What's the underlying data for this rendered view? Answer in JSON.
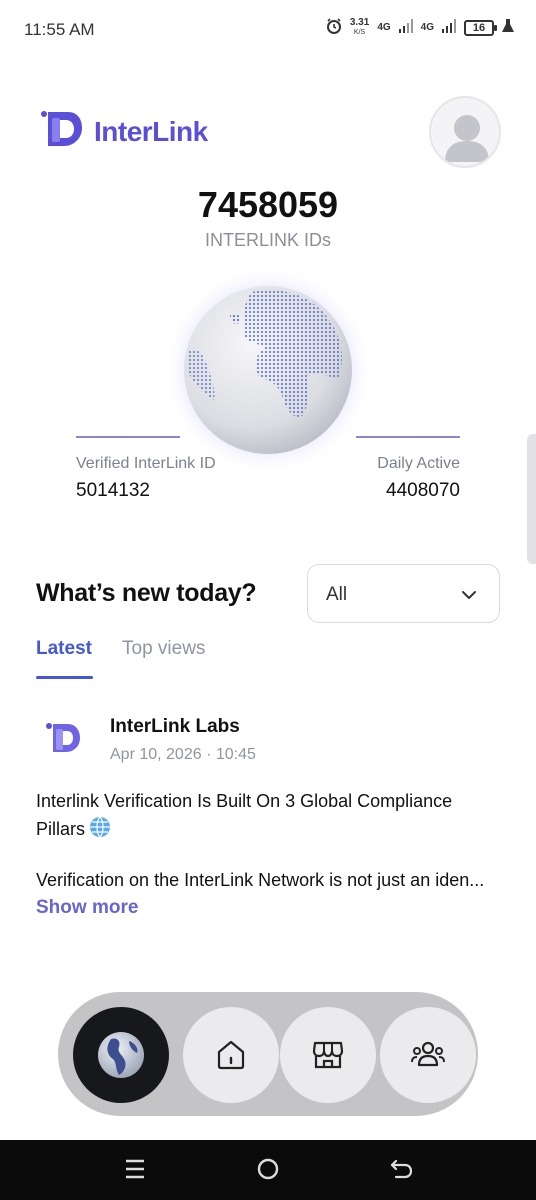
{
  "status_bar": {
    "time": "11:55 AM",
    "speed_value": "3.31",
    "speed_unit": "K/S",
    "network_1": "4G",
    "network_2": "4G",
    "battery": "16"
  },
  "header": {
    "brand": "InterLink"
  },
  "stats": {
    "total_count": "7458059",
    "total_label": "INTERLINK IDs",
    "verified_label": "Verified InterLink ID",
    "verified_value": "5014132",
    "daily_label": "Daily Active",
    "daily_value": "4408070"
  },
  "news": {
    "title": "What’s new today?",
    "filter_value": "All",
    "tabs": [
      {
        "label": "Latest",
        "active": true
      },
      {
        "label": "Top views",
        "active": false
      }
    ]
  },
  "post": {
    "author": "InterLink Labs",
    "date": "Apr 10, 2026 · 10:45",
    "title": "Interlink Verification Is Built On 3 Global Compliance Pillars",
    "body": "Verification on the InterLink Network is not just an iden...",
    "show_more": "Show more"
  },
  "bottom_nav": {
    "items": [
      {
        "icon": "globe-icon",
        "active": true
      },
      {
        "icon": "home-icon",
        "active": false
      },
      {
        "icon": "store-icon",
        "active": false
      },
      {
        "icon": "community-icon",
        "active": false
      }
    ]
  },
  "colors": {
    "brand": "#5b4fd8",
    "tab_active": "#4457d6",
    "show_more": "#6a64d0",
    "nav_active": "#17181c"
  }
}
